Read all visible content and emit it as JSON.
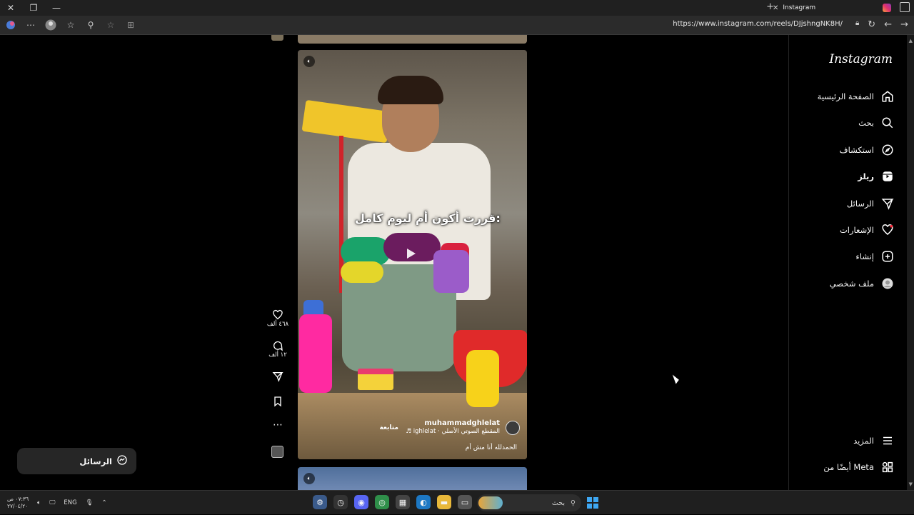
{
  "browser": {
    "tab_title": "Instagram",
    "url": "https://www.instagram.com/reels/DJjshngNK8H/"
  },
  "instagram": {
    "logo": "Instagram",
    "nav": [
      {
        "label": "الصفحة الرئيسية",
        "icon": "home-icon"
      },
      {
        "label": "بحث",
        "icon": "search-icon"
      },
      {
        "label": "استكشاف",
        "icon": "compass-icon"
      },
      {
        "label": "ريلز",
        "icon": "reels-icon"
      },
      {
        "label": "الرسائل",
        "icon": "send-icon"
      },
      {
        "label": "الإشعارات",
        "icon": "heart-icon"
      },
      {
        "label": "إنشاء",
        "icon": "plus-icon"
      },
      {
        "label": "ملف شخصي",
        "icon": "profile-icon"
      }
    ],
    "more_label": "المزيد",
    "meta_label": "أيضًا من Meta"
  },
  "reel": {
    "overlay_text": "قررت أكون أم ليوم كامل:",
    "author": "muhammadghlelat",
    "follow_label": "متابعة",
    "audio": "ighlelat · المقطع الصوتي الأصلي",
    "caption": "الحمدلله أنا مش أم",
    "likes": "٤٦٨ ألف",
    "comments": "١٢ ألف"
  },
  "messages_pill": {
    "label": "الرسائل"
  },
  "taskbar": {
    "time": "٠٧:٣٦ ص",
    "date": "٢٧/٠٤/٢٠",
    "lang": "ENG",
    "search_placeholder": "بحث"
  }
}
